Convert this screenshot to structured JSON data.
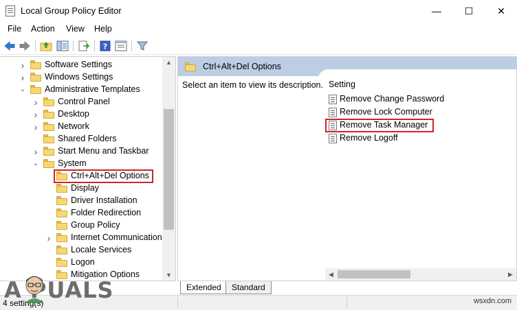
{
  "window": {
    "title": "Local Group Policy Editor",
    "minimize_glyph": "—",
    "maximize_glyph": "☐",
    "close_glyph": "✕"
  },
  "menu": [
    "File",
    "Action",
    "View",
    "Help"
  ],
  "toolbar": {
    "icons": [
      "back-arrow-icon",
      "forward-arrow-icon",
      "up-folder-icon",
      "show-hide-tree-icon",
      "export-list-icon",
      "help-icon",
      "properties-pane-icon",
      "filter-icon"
    ]
  },
  "tree": {
    "items": [
      {
        "label": "Software Settings",
        "expander": "›",
        "depth": 1
      },
      {
        "label": "Windows Settings",
        "expander": "›",
        "depth": 1
      },
      {
        "label": "Administrative Templates",
        "expander": "⌄",
        "depth": 1
      },
      {
        "label": "Control Panel",
        "expander": "›",
        "depth": 2
      },
      {
        "label": "Desktop",
        "expander": "›",
        "depth": 2
      },
      {
        "label": "Network",
        "expander": "›",
        "depth": 2
      },
      {
        "label": "Shared Folders",
        "expander": "",
        "depth": 2
      },
      {
        "label": "Start Menu and Taskbar",
        "expander": "›",
        "depth": 2
      },
      {
        "label": "System",
        "expander": "⌄",
        "depth": 2
      },
      {
        "label": "Ctrl+Alt+Del Options",
        "expander": "",
        "depth": 3,
        "selected": true
      },
      {
        "label": "Display",
        "expander": "",
        "depth": 3
      },
      {
        "label": "Driver Installation",
        "expander": "",
        "depth": 3
      },
      {
        "label": "Folder Redirection",
        "expander": "",
        "depth": 3
      },
      {
        "label": "Group Policy",
        "expander": "",
        "depth": 3
      },
      {
        "label": "Internet Communication",
        "expander": "›",
        "depth": 3
      },
      {
        "label": "Locale Services",
        "expander": "",
        "depth": 3
      },
      {
        "label": "Logon",
        "expander": "",
        "depth": 3
      },
      {
        "label": "Mitigation Options",
        "expander": "",
        "depth": 3
      }
    ],
    "scroll_up_glyph": "▲",
    "scroll_down_glyph": "▼"
  },
  "details": {
    "header_title": "Ctrl+Alt+Del Options",
    "description": "Select an item to view its description.",
    "column_header": "Setting",
    "settings": [
      {
        "label": "Remove Change Password"
      },
      {
        "label": "Remove Lock Computer"
      },
      {
        "label": "Remove Task Manager",
        "highlighted": true
      },
      {
        "label": "Remove Logoff"
      }
    ],
    "scroll_left_glyph": "◀",
    "scroll_right_glyph": "▶"
  },
  "tabs": [
    {
      "label": "Extended",
      "active": true
    },
    {
      "label": "Standard",
      "active": false
    }
  ],
  "status": {
    "text": "4 setting(s)"
  },
  "watermark": {
    "text": "A PUALS",
    "site": "wsxdn.com"
  },
  "colors": {
    "header_bg": "#bccde4",
    "highlight_border": "#d02424",
    "folder_fill": "#f8d775"
  }
}
